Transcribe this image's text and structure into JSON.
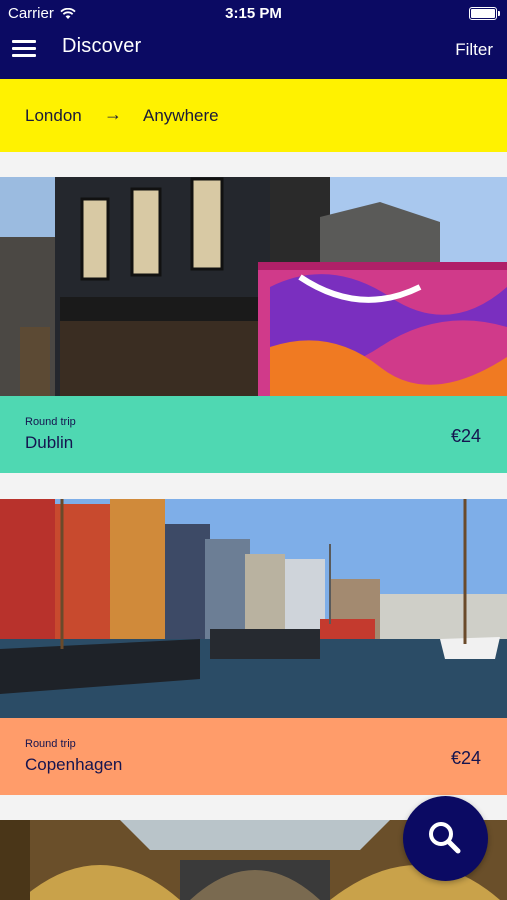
{
  "status_bar": {
    "carrier": "Carrier",
    "time": "3:15 PM"
  },
  "nav": {
    "title": "Discover",
    "filter_label": "Filter"
  },
  "route": {
    "from": "London",
    "arrow": "→",
    "to": "Anywhere"
  },
  "cards": [
    {
      "trip_type": "Round trip",
      "city": "Dublin",
      "price": "€24",
      "color": "#4fd8b2"
    },
    {
      "trip_type": "Round trip",
      "city": "Copenhagen",
      "price": "€24",
      "color": "#ff9c6a"
    }
  ],
  "colors": {
    "nav": "#0b0a63",
    "route": "#fff200",
    "fab": "#0b0a63"
  },
  "icons": {
    "menu": "hamburger-icon",
    "wifi": "wifi-icon",
    "battery": "battery-icon",
    "search": "search-icon"
  }
}
